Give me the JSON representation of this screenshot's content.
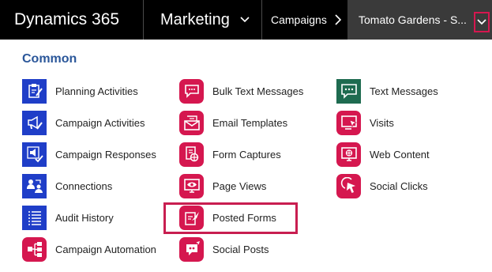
{
  "topbar": {
    "app_name": "Dynamics 365",
    "module": "Marketing",
    "area": "Campaigns",
    "record": "Tomato Gardens - S..."
  },
  "menu": {
    "section_title": "Common",
    "col1": [
      {
        "label": "Planning Activities",
        "icon": "clipboard-pen-icon"
      },
      {
        "label": "Campaign Activities",
        "icon": "megaphone-pen-icon"
      },
      {
        "label": "Campaign Responses",
        "icon": "megaphone-check-icon"
      },
      {
        "label": "Connections",
        "icon": "people-connect-icon"
      },
      {
        "label": "Audit History",
        "icon": "list-icon"
      },
      {
        "label": "Campaign Automation",
        "icon": "flow-icon"
      }
    ],
    "col2": [
      {
        "label": "Bulk Text Messages",
        "icon": "chat-bubble-icon"
      },
      {
        "label": "Email Templates",
        "icon": "envelope-icon"
      },
      {
        "label": "Form Captures",
        "icon": "form-capture-icon"
      },
      {
        "label": "Page Views",
        "icon": "monitor-eye-icon"
      },
      {
        "label": "Posted Forms",
        "icon": "posted-form-icon"
      },
      {
        "label": "Social Posts",
        "icon": "social-bubble-icon"
      }
    ],
    "col3": [
      {
        "label": "Text Messages",
        "icon": "text-message-icon"
      },
      {
        "label": "Visits",
        "icon": "monitor-cursor-icon"
      },
      {
        "label": "Web Content",
        "icon": "monitor-globe-icon"
      },
      {
        "label": "Social Clicks",
        "icon": "click-icon"
      }
    ]
  },
  "colors": {
    "topbar": "#000000",
    "record_bg": "#3a3a3a",
    "section_title": "#2b579a",
    "icon_blue": "#1f3ec8",
    "icon_pink": "#d5174f",
    "icon_green": "#1e6b50",
    "highlight": "#c81e50"
  }
}
